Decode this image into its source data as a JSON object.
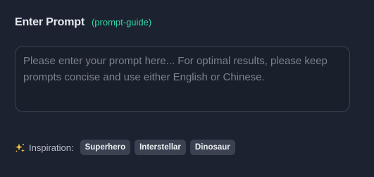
{
  "header": {
    "title": "Enter Prompt",
    "guide_link": "(prompt-guide)"
  },
  "prompt": {
    "value": "",
    "placeholder": "Please enter your prompt here... For optimal results, please keep prompts concise and use either English or Chinese."
  },
  "inspiration": {
    "icon": "sparkle-icon",
    "label": "Inspiration:",
    "chips": [
      {
        "label": "Superhero"
      },
      {
        "label": "Interstellar"
      },
      {
        "label": "Dinosaur"
      }
    ]
  },
  "colors": {
    "background": "#1c2230",
    "accent": "#2fd8a6",
    "sparkle": "#f5c542",
    "chip_background": "#3a4252",
    "input_border": "#3a4354"
  }
}
